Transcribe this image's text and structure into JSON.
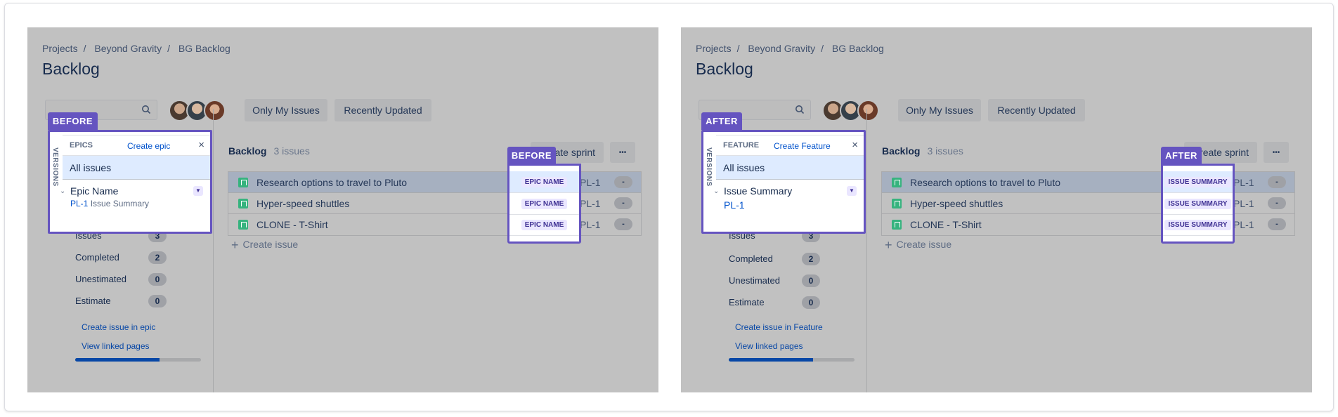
{
  "colors": {
    "highlight": "#6554c0",
    "lozenge_bg": "#eae6ff",
    "lozenge_text": "#403294",
    "link": "#0052cc",
    "issue_icon": "#36b37e"
  },
  "panels": [
    {
      "tag": "BEFORE",
      "breadcrumb": [
        "Projects",
        "Beyond Gravity",
        "BG Backlog"
      ],
      "title": "Backlog",
      "filters": [
        "Only My Issues",
        "Recently Updated"
      ],
      "popup": {
        "vertical_tab": "VERSIONS",
        "heading": "EPICS",
        "create_link": "Create epic",
        "close": "×",
        "all_issues": "All issues",
        "item_name": "Epic Name",
        "item_key": "PL-1",
        "item_summary": "Issue Summary"
      },
      "backlog": {
        "title": "Backlog",
        "count": "3 issues",
        "create_sprint": "Create sprint",
        "more": "•••",
        "create_issue": "Create issue"
      },
      "issues": [
        {
          "summary": "Research options to travel to Pluto",
          "label": "EPIC NAME",
          "key": "PL-1",
          "estimate": "-",
          "selected": true
        },
        {
          "summary": "Hyper-speed shuttles",
          "label": "EPIC NAME",
          "key": "PL-1",
          "estimate": "-"
        },
        {
          "summary": "CLONE - T-Shirt",
          "label": "EPIC NAME",
          "key": "PL-1",
          "estimate": "-"
        }
      ],
      "stats": [
        {
          "label": "Issues",
          "value": "3"
        },
        {
          "label": "Completed",
          "value": "2"
        },
        {
          "label": "Unestimated",
          "value": "0"
        },
        {
          "label": "Estimate",
          "value": "0"
        }
      ],
      "links": [
        "Create issue in epic",
        "View linked pages"
      ],
      "progress": 0.67
    },
    {
      "tag": "AFTER",
      "breadcrumb": [
        "Projects",
        "Beyond Gravity",
        "BG Backlog"
      ],
      "title": "Backlog",
      "filters": [
        "Only My Issues",
        "Recently Updated"
      ],
      "popup": {
        "vertical_tab": "VERSIONS",
        "heading": "FEATURE",
        "create_link": "Create Feature",
        "close": "×",
        "all_issues": "All issues",
        "item_name": "Issue Summary",
        "item_key": "PL-1",
        "item_summary": ""
      },
      "backlog": {
        "title": "Backlog",
        "count": "3 issues",
        "create_sprint": "Create sprint",
        "more": "•••",
        "create_issue": "Create issue"
      },
      "issues": [
        {
          "summary": "Research options to travel to Pluto",
          "label": "ISSUE SUMMARY",
          "key": "PL-1",
          "estimate": "-",
          "selected": true
        },
        {
          "summary": "Hyper-speed shuttles",
          "label": "ISSUE SUMMARY",
          "key": "PL-1",
          "estimate": "-"
        },
        {
          "summary": "CLONE - T-Shirt",
          "label": "ISSUE SUMMARY",
          "key": "PL-1",
          "estimate": "-"
        }
      ],
      "stats": [
        {
          "label": "Issues",
          "value": "3"
        },
        {
          "label": "Completed",
          "value": "2"
        },
        {
          "label": "Unestimated",
          "value": "0"
        },
        {
          "label": "Estimate",
          "value": "0"
        }
      ],
      "links": [
        "Create issue in Feature",
        "View linked pages"
      ],
      "progress": 0.67
    }
  ]
}
